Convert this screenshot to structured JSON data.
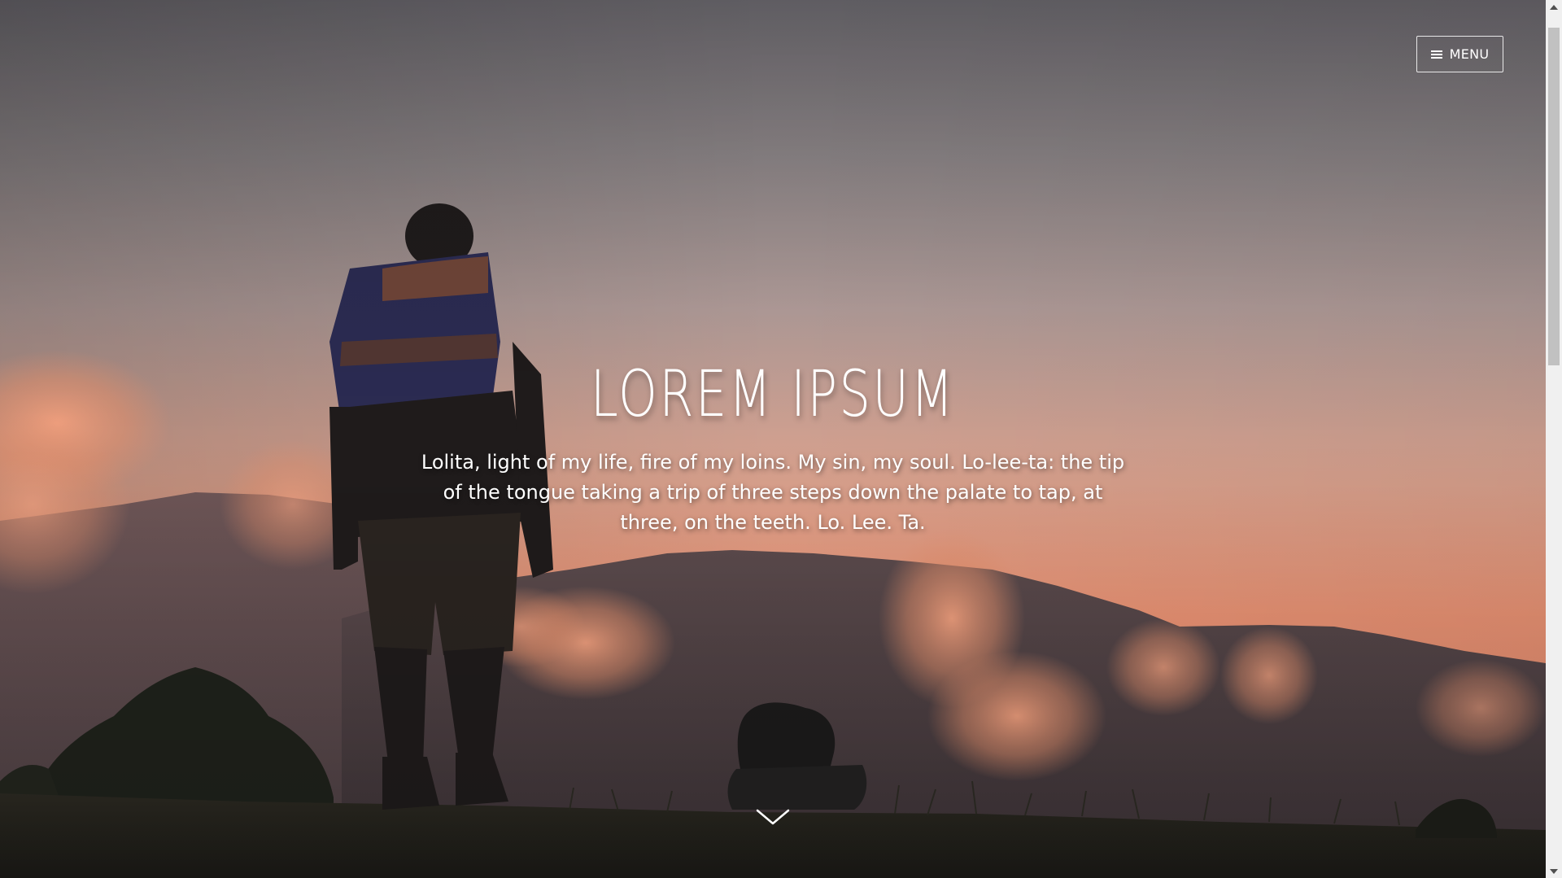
{
  "header": {
    "menu_label": "MENU"
  },
  "hero": {
    "title": "LOREM IPSUM",
    "text": "Lolita, light of my life, fire of my loins. My sin, my soul. Lo-lee-ta: the tip of the tongue taking a trip of three steps down the palate to tap, at three, on the teeth. Lo. Lee. Ta."
  },
  "icons": {
    "menu": "hamburger-icon",
    "scroll": "chevron-down-icon"
  },
  "colors": {
    "text": "#ffffff",
    "sky_top": "#6e6a72",
    "sky_bottom": "#e8906e"
  }
}
